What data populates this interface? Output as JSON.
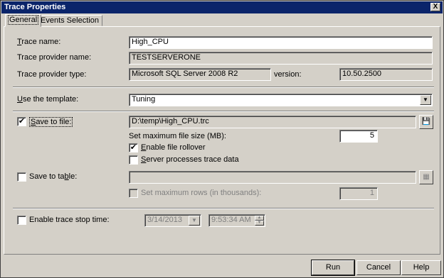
{
  "window": {
    "title": "Trace Properties",
    "close_glyph": "X"
  },
  "tabs": [
    {
      "label": "General"
    },
    {
      "label": "Events Selection"
    }
  ],
  "general": {
    "trace_name": {
      "label_u": "T",
      "label_rest": "race name:",
      "value": "High_CPU"
    },
    "provider_name": {
      "label": "Trace provider name:",
      "value": "TESTSERVERONE"
    },
    "provider_type": {
      "label": "Trace provider type:",
      "value": "Microsoft SQL Server 2008 R2",
      "version_label": "version:",
      "version_value": "10.50.2500"
    },
    "template": {
      "label_u": "U",
      "label_rest": "se the template:",
      "value": "Tuning"
    },
    "save_to_file": {
      "label_u": "S",
      "label_rest": "ave to file:",
      "checked": true,
      "path": "D:\\temp\\High_CPU.trc"
    },
    "max_file_size": {
      "label": "Set maximum file size (MB):",
      "value": "5"
    },
    "file_rollover": {
      "label_pre": "E",
      "label_rest": "nable file rollover",
      "checked": true
    },
    "server_processes": {
      "label_pre": "S",
      "label_rest": "erver processes trace data",
      "checked": false
    },
    "save_to_table": {
      "label_pre": "Save to ta",
      "label_u": "b",
      "label_rest": "le:",
      "checked": false,
      "value": ""
    },
    "max_rows": {
      "label": "Set maximum rows (in thousands):",
      "value": "1",
      "checked": false
    },
    "stop_time": {
      "label": "Enable trace stop time:",
      "checked": false,
      "date": "3/14/2013",
      "time": "9:53:34 AM"
    }
  },
  "buttons": {
    "run": "Run",
    "cancel": "Cancel",
    "help": "Help"
  },
  "colors": {
    "titlebar": "#0a246a",
    "face": "#d4d0c8"
  }
}
